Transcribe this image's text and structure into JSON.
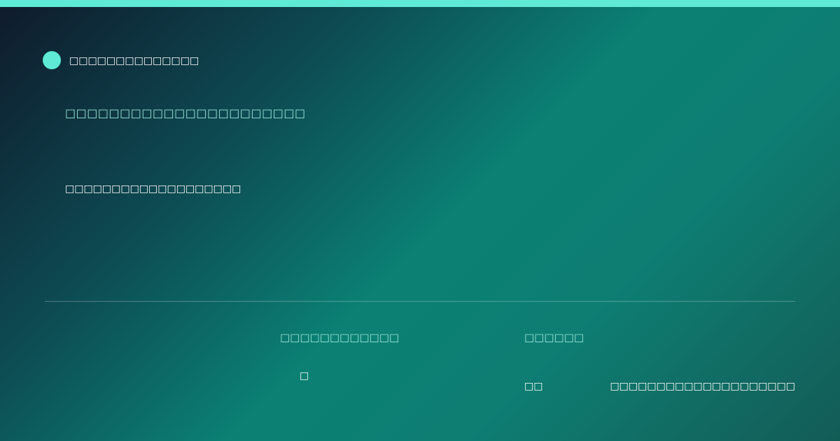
{
  "brand": {
    "name": "□□□□□□□□□□□□□□",
    "dot_color": "#5eead4"
  },
  "hero": {
    "headline": "□□□□□□□□□□□□□□□□□□□□□□",
    "subline": "□□□□□□□□□□□□□□□□□□□"
  },
  "stats": {
    "col_a": {
      "label": "□□□□□□□□□□□□",
      "value": "□"
    },
    "col_b": {
      "label": "□□□□□□",
      "value": "□□",
      "extra": "□□□□□□□□□□□□□□□□□□□□"
    }
  },
  "colors": {
    "accent": "#5eead4",
    "accent_text": "#99e6d8",
    "gradient_start": "#0f1a2b",
    "gradient_mid": "#0b8073",
    "gradient_end": "#135c56"
  }
}
